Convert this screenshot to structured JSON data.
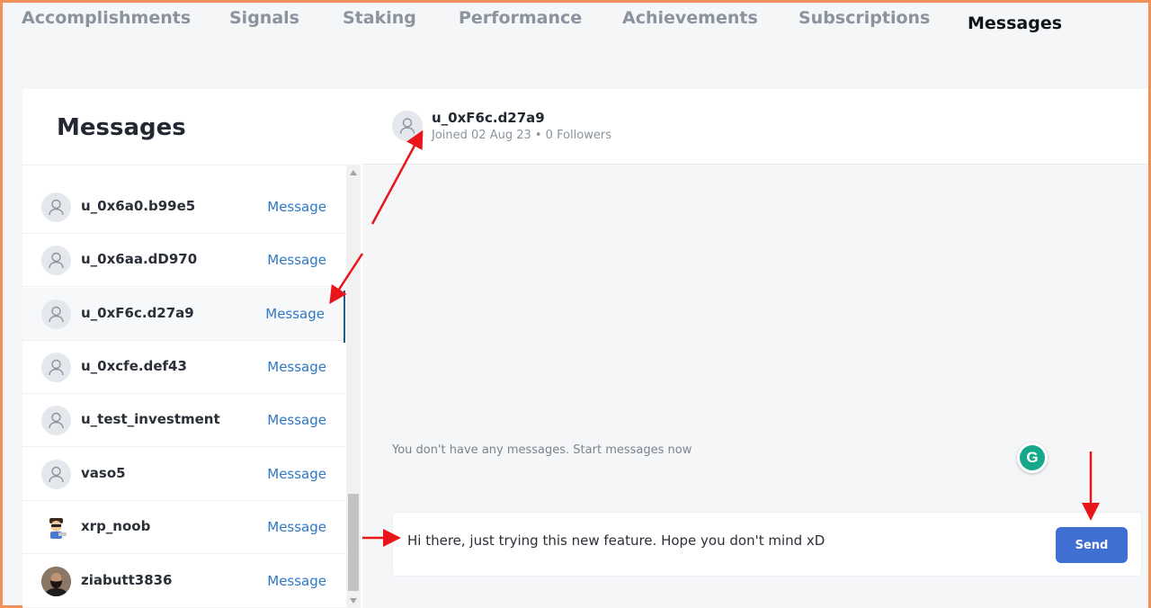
{
  "tabs": [
    {
      "label": "Accomplishments"
    },
    {
      "label": "Signals"
    },
    {
      "label": "Staking"
    },
    {
      "label": "Performance"
    },
    {
      "label": "Achievements"
    },
    {
      "label": "Subscriptions"
    },
    {
      "label": "Messages",
      "active": true
    }
  ],
  "left": {
    "title": "Messages",
    "rows": [
      {
        "name": "u_0x6a0.b99e5",
        "action": "Message",
        "avatar": "user-icon"
      },
      {
        "name": "u_0x6aa.dD970",
        "action": "Message",
        "avatar": "user-icon"
      },
      {
        "name": "u_0xF6c.d27a9",
        "action": "Message",
        "avatar": "user-icon",
        "selected": true
      },
      {
        "name": "u_0xcfe.def43",
        "action": "Message",
        "avatar": "user-icon"
      },
      {
        "name": "u_test_investment",
        "action": "Message",
        "avatar": "user-icon"
      },
      {
        "name": "vaso5",
        "action": "Message",
        "avatar": "user-icon"
      },
      {
        "name": "xrp_noob",
        "action": "Message",
        "avatar": "cartoon-avatar"
      },
      {
        "name": "ziabutt3836",
        "action": "Message",
        "avatar": "photo-avatar"
      }
    ]
  },
  "chat": {
    "name": "u_0xF6c.d27a9",
    "subtitle": "Joined 02 Aug 23 • 0 Followers",
    "empty_text": "You don't have any messages. Start messages now",
    "input_value": "Hi there, just trying this new feature. Hope you don't mind xD",
    "send_label": "Send",
    "grammarly_letter": "G"
  },
  "colors": {
    "accent": "#3f6fd0",
    "link": "#2f78c4",
    "annotation": "#e8161b",
    "frame": "#f0905a"
  }
}
